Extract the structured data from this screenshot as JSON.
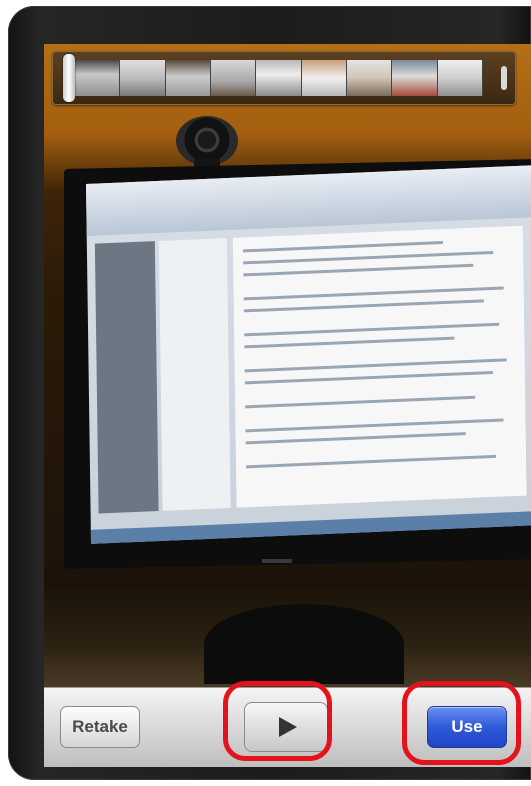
{
  "toolbar": {
    "retake_label": "Retake",
    "use_label": "Use",
    "play_icon": "play-icon"
  },
  "scrubber": {
    "frame_count": 9,
    "position": 0.0
  },
  "colors": {
    "use_button": "#2f5ad9",
    "highlight": "#e3121b"
  }
}
